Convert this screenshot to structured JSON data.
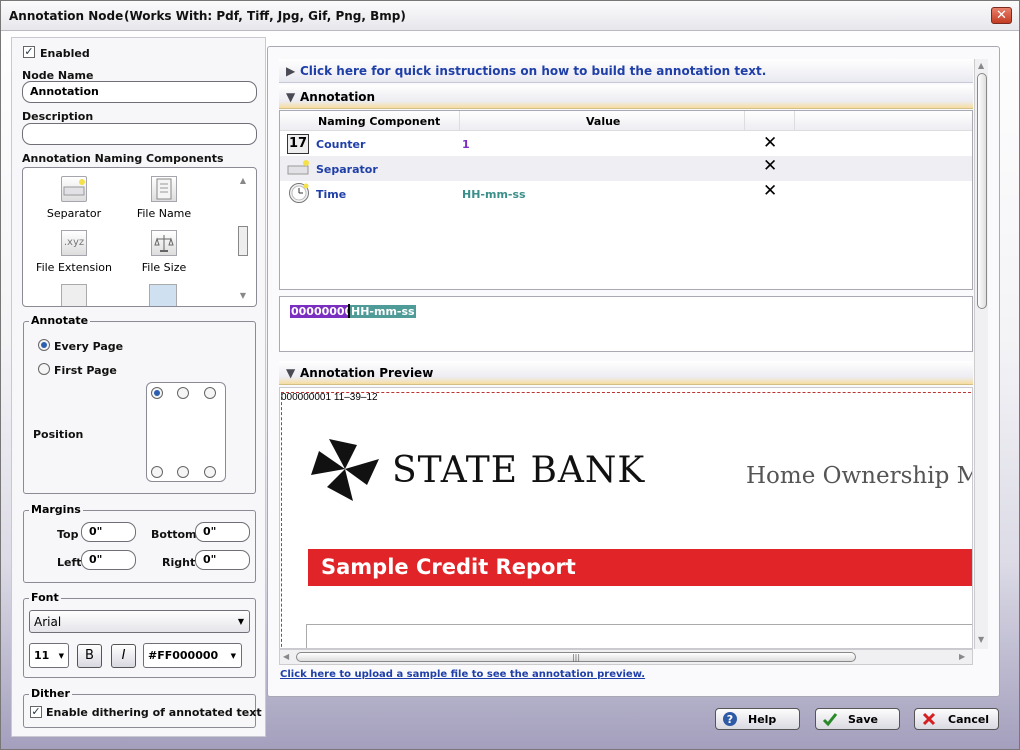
{
  "window": {
    "title": "Annotation Node",
    "subtitle": "(Works With: Pdf, Tiff, Jpg, Gif, Png, Bmp)",
    "close_glyph": "✕"
  },
  "left": {
    "enabled_label": "Enabled",
    "node_name_label": "Node Name",
    "node_name_value": "Annotation",
    "description_label": "Description",
    "description_value": "",
    "components_label": "Annotation Naming Components",
    "components": [
      {
        "label": "Separator",
        "icon": "separator-icon"
      },
      {
        "label": "File Name",
        "icon": "file-name-icon"
      },
      {
        "label": "File Extension",
        "icon": "file-extension-icon",
        "glyph": ".xyz"
      },
      {
        "label": "File Size",
        "icon": "file-size-icon"
      }
    ],
    "annotate_title": "Annotate",
    "every_page_label": "Every Page",
    "first_page_label": "First Page",
    "position_label": "Position",
    "margins_title": "Margins",
    "top_label": "Top",
    "top_value": "0\"",
    "bottom_label": "Bottom",
    "bottom_value": "0\"",
    "left_label": "Left",
    "left_value": "0\"",
    "right_label": "Right",
    "right_value": "0\"",
    "font_title": "Font",
    "font_family": "Arial",
    "font_size": "11",
    "bold_label": "B",
    "italic_label": "I",
    "font_color": "#FF000000",
    "dither_title": "Dither",
    "dither_label": "Enable dithering of annotated text"
  },
  "right": {
    "instructions_link": "Click here for quick instructions on how to build the annotation text.",
    "annotation_header": "Annotation",
    "table_headers": [
      "Naming Component",
      "Value"
    ],
    "rows": [
      {
        "icon": "counter-icon",
        "name": "Counter",
        "value": "1",
        "value_color": "#7b2fc0"
      },
      {
        "icon": "separator-icon",
        "name": "Separator",
        "value": "",
        "value_color": "#000000"
      },
      {
        "icon": "clock-icon",
        "name": "Time",
        "value": "HH-mm-ss",
        "value_color": "#3a8f8a"
      }
    ],
    "token_counter": "000000001",
    "token_time": "HH-mm-ss",
    "preview_header": "Annotation Preview",
    "preview_stamp": "000000001 11–39–12",
    "bank_name": "STATE BANK",
    "bank_tagline": "Home Ownership M",
    "report_title": "Sample Credit Report",
    "upload_link": "Click here to upload a sample file to see the annotation preview."
  },
  "footer": {
    "help_label": "Help",
    "save_label": "Save",
    "cancel_label": "Cancel"
  },
  "colors": {
    "accent_link": "#1f3fa8",
    "report_band": "#e02428",
    "counter_token": "#7b2fc0",
    "time_token": "#4f9b98"
  }
}
